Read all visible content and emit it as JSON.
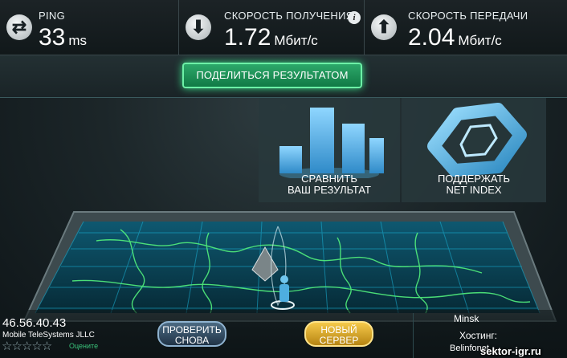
{
  "metrics": {
    "ping": {
      "label": "PING",
      "value": "33",
      "unit": "ms",
      "icon": "ping-icon"
    },
    "download": {
      "label": "СКОРОСТЬ ПОЛУЧЕНИЯ",
      "value": "1.72",
      "unit": "Мбит/с",
      "icon": "download-arrow-icon"
    },
    "upload": {
      "label": "СКОРОСТЬ ПЕРЕДАЧИ",
      "value": "2.04",
      "unit": "Мбит/с",
      "icon": "upload-arrow-icon"
    }
  },
  "share_label": "ПОДЕЛИТЬСЯ РЕЗУЛЬТАТОМ",
  "compare": {
    "line1": "СРАВНИТЬ",
    "line2": "ВАШ РЕЗУЛЬТАТ"
  },
  "netindex": {
    "line1": "ПОДДЕРЖАТЬ",
    "line2": "NET INDEX"
  },
  "client": {
    "ip": "46.56.40.43",
    "isp": "Mobile TeleSystems JLLC",
    "rate_label": "Оцените",
    "stars": "☆☆☆☆☆"
  },
  "buttons": {
    "again": {
      "line1": "ПРОВЕРИТЬ",
      "line2": "СНОВА"
    },
    "server": {
      "line1": "НОВЫЙ",
      "line2": "СЕРВЕР"
    }
  },
  "server": {
    "city": "Minsk",
    "host_label": "Хостинг:",
    "host_name": "Belinfonet"
  },
  "watermark": "sektor-igr.ru",
  "colors": {
    "share": "#1e9a5a",
    "server_button": "#e0a82a",
    "again_button": "#35506a",
    "map_grid": "#1aa6c8",
    "borders": "#3fd07a"
  }
}
